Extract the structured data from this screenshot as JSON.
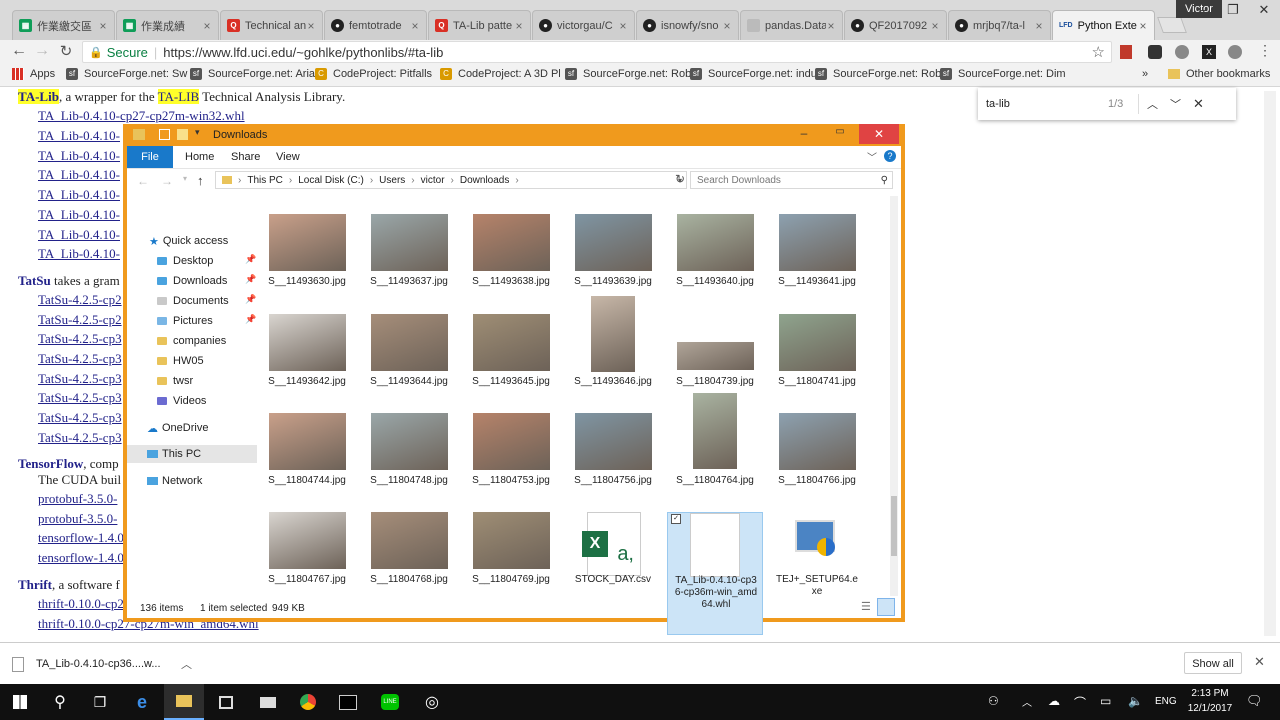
{
  "tabs": [
    {
      "label": "作業繳交區",
      "favicon_color": "#0f9d58",
      "active": false
    },
    {
      "label": "作業成績",
      "favicon_color": "#0f9d58",
      "active": false
    },
    {
      "label": "Technical an",
      "favicon_color": "#d93025",
      "active": false
    },
    {
      "label": "femtotrade",
      "favicon_color": "#222222",
      "active": false
    },
    {
      "label": "TA-Lib patte",
      "favicon_color": "#d93025",
      "active": false
    },
    {
      "label": "victorgau/C",
      "favicon_color": "#222222",
      "active": false
    },
    {
      "label": "isnowfy/sno",
      "favicon_color": "#222222",
      "active": false
    },
    {
      "label": "pandas.Data",
      "favicon_color": "#888888",
      "active": false
    },
    {
      "label": "QF2017092",
      "favicon_color": "#222222",
      "active": false
    },
    {
      "label": "mrjbq7/ta-l",
      "favicon_color": "#222222",
      "active": false
    },
    {
      "label": "Python Exte",
      "favicon_color": "#1b4f9c",
      "active": true,
      "prefix": "LFD"
    }
  ],
  "user_name": "Victor",
  "address": {
    "secure_label": "Secure",
    "url": "https://www.lfd.uci.edu/~gohlke/pythonlibs/#ta-lib"
  },
  "bookmarks": {
    "apps_label": "Apps",
    "items": [
      "SourceForge.net: Sw",
      "SourceForge.net: Aria",
      "CodeProject: Pitfalls",
      "CodeProject: A 3D Pl",
      "SourceForge.net: Rob",
      "SourceForge.net: indu",
      "SourceForge.net: Rob",
      "SourceForge.net: Dim"
    ],
    "more": "»",
    "other": "Other bookmarks"
  },
  "page": {
    "talib_heading": "TA-Lib",
    "talib_desc": ", a wrapper for the ",
    "talib_hl": "TA-LIB",
    "talib_rest": " Technical Analysis Library.",
    "talib_links": [
      "TA_Lib-0.4.10-cp27-cp27m-win32.whl",
      "TA_Lib-0.4.10-",
      "TA_Lib-0.4.10-",
      "TA_Lib-0.4.10-",
      "TA_Lib-0.4.10-",
      "TA_Lib-0.4.10-",
      "TA_Lib-0.4.10-",
      "TA_Lib-0.4.10-"
    ],
    "tatsu_heading": "TatSu",
    "tatsu_desc": " takes a gram",
    "tatsu_links": [
      "TatSu-4.2.5-cp2",
      "TatSu-4.2.5-cp2",
      "TatSu-4.2.5-cp3",
      "TatSu-4.2.5-cp3",
      "TatSu-4.2.5-cp3",
      "TatSu-4.2.5-cp3",
      "TatSu-4.2.5-cp3",
      "TatSu-4.2.5-cp3"
    ],
    "tf_heading": "TensorFlow",
    "tf_desc": ", comp",
    "tf_line2": "The CUDA buil",
    "tf_links": [
      "protobuf-3.5.0-",
      "protobuf-3.5.0-",
      "tensorflow-1.4.0",
      "tensorflow-1.4.0"
    ],
    "thrift_heading": "Thrift",
    "thrift_desc": ", a software f",
    "thrift_links": [
      "thrift-0.10.0-cp2",
      "thrift-0.10.0-cp27-cp27m-win_amd64.whl"
    ]
  },
  "findbar": {
    "query": "ta-lib",
    "count": "1/3"
  },
  "explorer": {
    "title": "Downloads",
    "ribbon_tabs": [
      "File",
      "Home",
      "Share",
      "View"
    ],
    "breadcrumb": [
      "This PC",
      "Local Disk (C:)",
      "Users",
      "victor",
      "Downloads"
    ],
    "search_placeholder": "Search Downloads",
    "nav": {
      "quick_access": "Quick access",
      "pinned": [
        "Desktop",
        "Downloads",
        "Documents",
        "Pictures"
      ],
      "folders": [
        "companies",
        "HW05",
        "twsr",
        "Videos"
      ],
      "onedrive": "OneDrive",
      "thispc": "This PC",
      "network": "Network"
    },
    "files": [
      "S__11493630.jpg",
      "S__11493637.jpg",
      "S__11493638.jpg",
      "S__11493639.jpg",
      "S__11493640.jpg",
      "S__11493641.jpg",
      "S__11493642.jpg",
      "S__11493644.jpg",
      "S__11493645.jpg",
      "S__11493646.jpg",
      "S__11804739.jpg",
      "S__11804741.jpg",
      "S__11804744.jpg",
      "S__11804748.jpg",
      "S__11804753.jpg",
      "S__11804756.jpg",
      "S__11804764.jpg",
      "S__11804766.jpg",
      "S__11804767.jpg",
      "S__11804768.jpg",
      "S__11804769.jpg",
      "STOCK_DAY.csv",
      "TA_Lib-0.4.10-cp36-cp36m-win_amd64.whl",
      "TEJ+_SETUP64.exe"
    ],
    "status": {
      "count": "136 items",
      "selected": "1 item selected",
      "size": "949 KB"
    }
  },
  "download_bar": {
    "file": "TA_Lib-0.4.10-cp36....w...",
    "show_all": "Show all"
  },
  "taskbar": {
    "lang": "ENG",
    "time": "2:13 PM",
    "date": "12/1/2017"
  },
  "colors": {
    "explorer_frame": "#f09a1d",
    "highlight": "#ffff2a",
    "link": "#22228a",
    "selection": "#cce4f7"
  }
}
